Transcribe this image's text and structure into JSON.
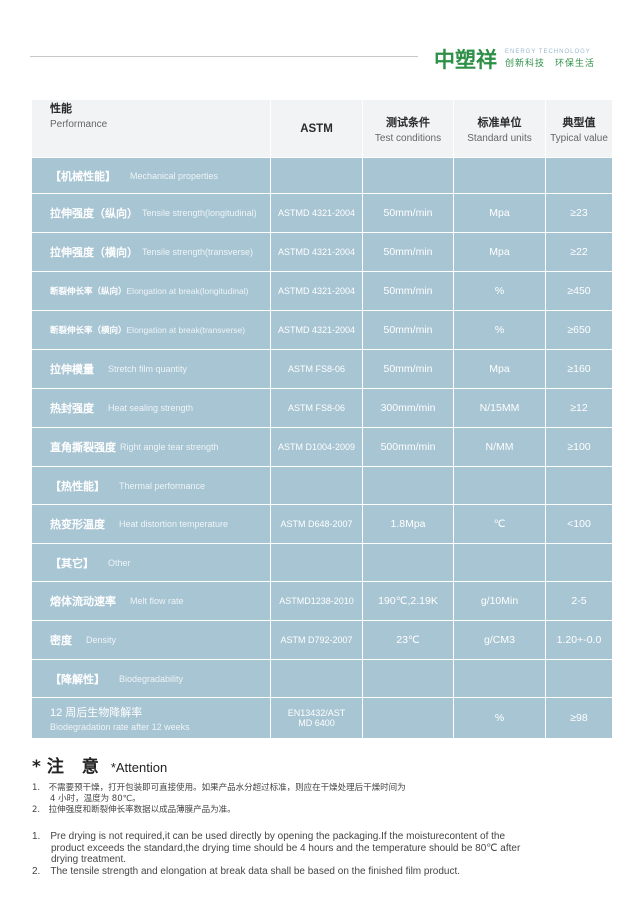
{
  "brand": {
    "name": "中塑祥",
    "tagline_en": "ENERGY TECHNOLOGY",
    "tagline_cn": "创新科技　环保生活"
  },
  "table": {
    "headers": [
      {
        "cn": "性能",
        "en": "Performance"
      },
      {
        "cn": "ASTM",
        "en": ""
      },
      {
        "cn": "测试条件",
        "en": "Test conditions"
      },
      {
        "cn": "标准单位",
        "en": "Standard units"
      },
      {
        "cn": "典型值",
        "en": "Typical value"
      }
    ],
    "rows": [
      {
        "zh": "【机械性能】",
        "en": "Mechanical properties",
        "astm": "",
        "cond": "",
        "unit": "",
        "val": ""
      },
      {
        "zh": "拉伸强度（纵向）",
        "en": "Tensile strength(longitudinal)",
        "astm": "ASTMD 4321-2004",
        "cond": "50mm/min",
        "unit": "Mpa",
        "val": "≥23"
      },
      {
        "zh": "拉伸强度（横向）",
        "en": "Tensile strength(transverse)",
        "astm": "ASTMD 4321-2004",
        "cond": "50mm/min",
        "unit": "Mpa",
        "val": "≥22"
      },
      {
        "zh": "断裂伸长率（纵向）",
        "en": "Elongation at break(longitudinal)",
        "astm": "ASTMD 4321-2004",
        "cond": "50mm/min",
        "unit": "%",
        "val": "≥450"
      },
      {
        "zh": "断裂伸长率（横向）",
        "en": "Elongation at break(transverse)",
        "astm": "ASTMD 4321-2004",
        "cond": "50mm/min",
        "unit": "%",
        "val": "≥650"
      },
      {
        "zh": "拉伸模量",
        "en": "Stretch film quantity",
        "astm": "ASTM FS8-06",
        "cond": "50mm/min",
        "unit": "Mpa",
        "val": "≥160"
      },
      {
        "zh": "热封强度",
        "en": "Heat sealing strength",
        "astm": "ASTM FS8-06",
        "cond": "300mm/min",
        "unit": "N/15MM",
        "val": "≥12"
      },
      {
        "zh": "直角撕裂强度",
        "en": "Right angle tear strength",
        "astm": "ASTM D1004-2009",
        "cond": "500mm/min",
        "unit": "N/MM",
        "val": "≥100"
      },
      {
        "zh": "【热性能】",
        "en": "Thermal performance",
        "astm": "",
        "cond": "",
        "unit": "",
        "val": ""
      },
      {
        "zh": "热变形温度",
        "en": "Heat distortion temperature",
        "astm": "ASTM D648-2007",
        "cond": "1.8Mpa",
        "unit": "℃",
        "val": "<100"
      },
      {
        "zh": "【其它】",
        "en": "Other",
        "astm": "",
        "cond": "",
        "unit": "",
        "val": ""
      },
      {
        "zh": "熔体流动速率",
        "en": "Melt flow rate",
        "astm": "ASTMD1238-2010",
        "cond": "190℃,2.19K",
        "unit": "g/10Min",
        "val": "2-5"
      },
      {
        "zh": "密度",
        "en": "Density",
        "astm": "ASTM D792-2007",
        "cond": "23℃",
        "unit": "g/CM3",
        "val": "1.20+-0.0"
      },
      {
        "zh": "【降解性】",
        "en": "Biodegradability",
        "astm": "",
        "cond": "",
        "unit": "",
        "val": ""
      },
      {
        "zh": "12 周后生物降解率",
        "en": "Biodegradation rate after 12 weeks",
        "astm_line1": "EN13432/AST",
        "astm_line2": "MD 6400",
        "cond": "",
        "unit": "%",
        "val": "≥98"
      }
    ]
  },
  "attention": {
    "title_cn": "*注 意",
    "title_en": "*Attention",
    "notes_cn": {
      "n1_line1": "1.　不需要预干燥，打开包装即可直接使用。如果产品水分超过标准，则应在干燥处理后干燥时间为",
      "n1_line2": "4 小时，温度为 80℃。",
      "n2": "2.　拉伸强度和断裂伸长率数据以成品薄膜产品为准。"
    },
    "notes_en": {
      "n1_line1": "1.　Pre drying is not required,it can be used directly by opening the packaging.If the moisturecontent of the",
      "n1_line2": "product exceeds the standard,the drying time should be 4 hours and the temperature should be 80℃ after",
      "n1_line3": "drying treatment.",
      "n2": "2.　The tensile strength and elongation at break data shall be based on the finished film product."
    }
  }
}
